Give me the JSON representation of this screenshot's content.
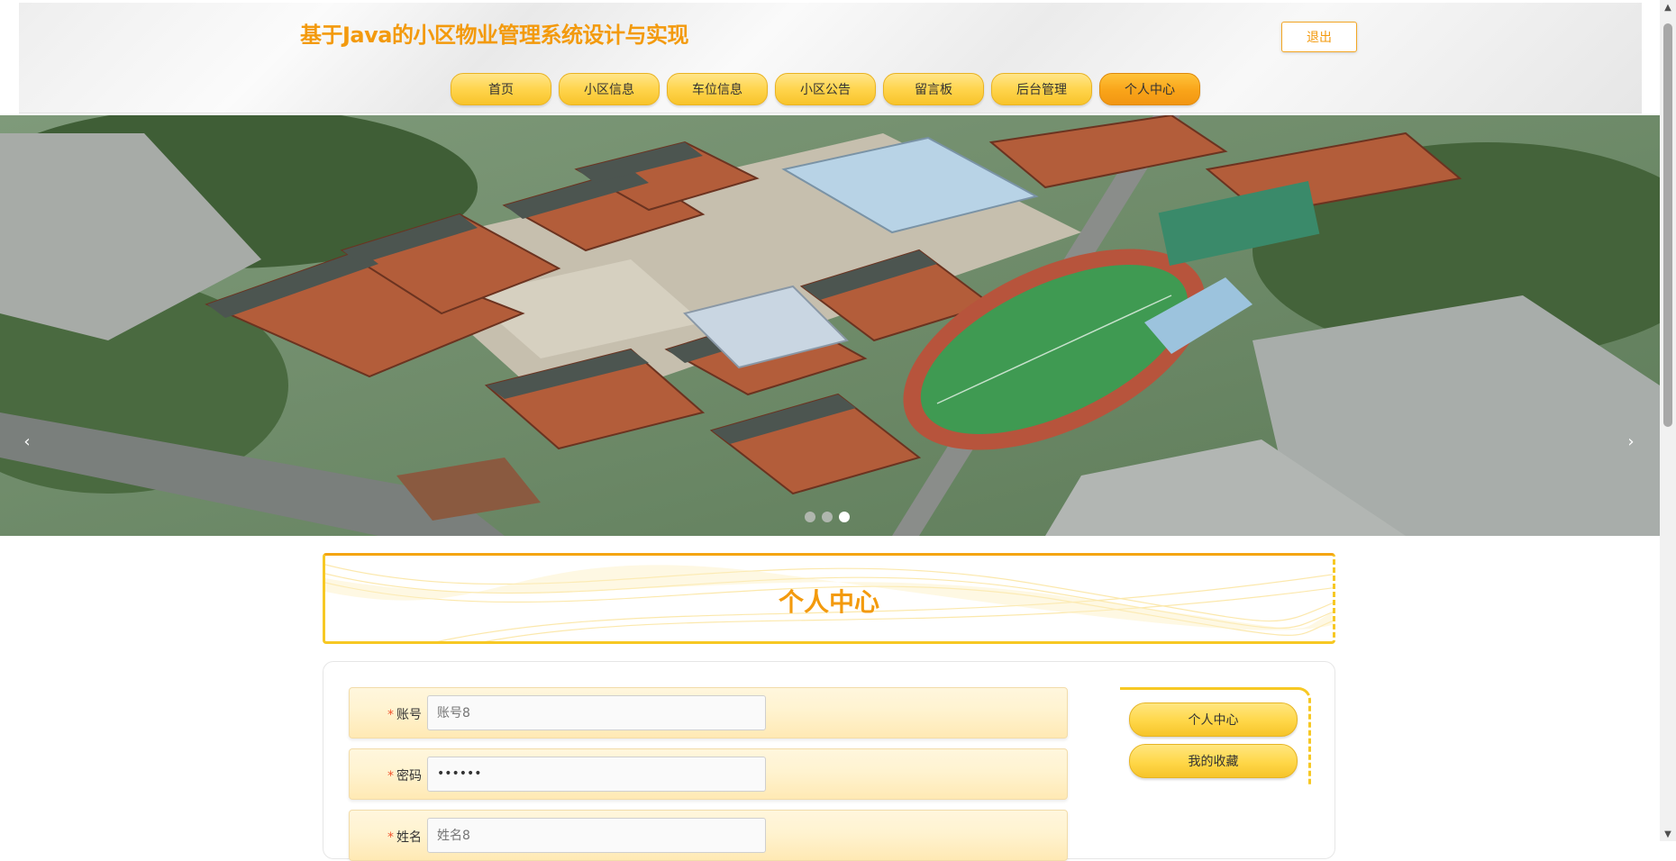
{
  "header": {
    "site_title": "基于Java的小区物业管理系统设计与实现",
    "logout_label": "退出"
  },
  "nav": {
    "items": [
      {
        "label": "首页"
      },
      {
        "label": "小区信息"
      },
      {
        "label": "车位信息"
      },
      {
        "label": "小区公告"
      },
      {
        "label": "留言板"
      },
      {
        "label": "后台管理"
      },
      {
        "label": "个人中心",
        "active": true
      }
    ]
  },
  "banner": {
    "prev_label": "‹",
    "next_label": "›",
    "slide_count": 3,
    "active_slide": 3
  },
  "section": {
    "title": "个人中心"
  },
  "form": {
    "account": {
      "label": "账号",
      "placeholder": "账号8"
    },
    "password": {
      "label": "密码",
      "value": "••••••"
    },
    "name": {
      "label": "姓名",
      "placeholder": "姓名8"
    }
  },
  "side_menu": {
    "items": [
      {
        "label": "个人中心"
      },
      {
        "label": "我的收藏"
      }
    ]
  },
  "colors": {
    "accent": "#f39a0d",
    "nav_gold": "#ffd54d",
    "nav_active": "#f9a419",
    "form_row": "#fff3d0"
  },
  "scrollbar": {
    "up_icon": "triangle-up-icon",
    "down_icon": "triangle-down-icon"
  }
}
